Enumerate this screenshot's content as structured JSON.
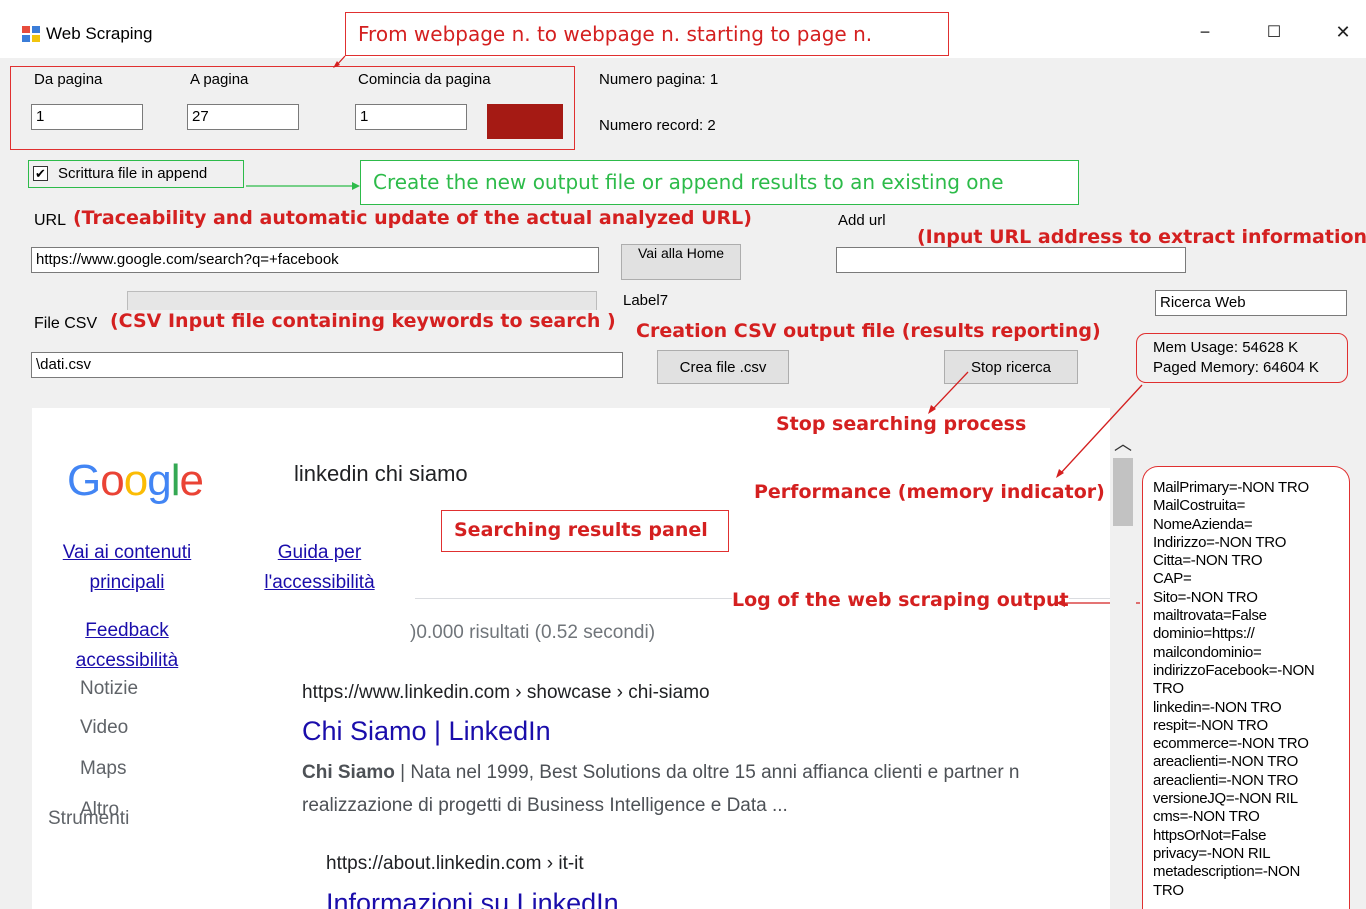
{
  "window": {
    "title": "Web Scraping",
    "minimize": "−",
    "maximize": "☐",
    "close": "✕"
  },
  "form": {
    "da_pagina_label": "Da pagina",
    "da_pagina_value": "1",
    "a_pagina_label": "A pagina",
    "a_pagina_value": "27",
    "comincia_label": "Comincia da pagina",
    "comincia_value": "1",
    "numero_pagina": "Numero pagina: 1",
    "numero_record": "Numero record: 2",
    "append_checkbox_label": "Scrittura file in append",
    "append_checked": true,
    "url_label": "URL",
    "url_value": "https://www.google.com/search?q=+facebook",
    "vai_home_button": "Vai alla Home",
    "add_url_label": "Add url",
    "add_url_value": "",
    "label7": "Label7",
    "ricerca_web_value": "Ricerca Web",
    "file_csv_label": "File CSV",
    "file_csv_value": "\\dati.csv",
    "crea_file_button": "Crea file .csv",
    "stop_button": "Stop ricerca",
    "mem_usage": "Mem Usage: 54628 K",
    "paged_memory": "Paged Memory: 64604 K"
  },
  "annotations": {
    "pages": "From webpage n.  to webpage n. starting to page n.",
    "append": "Create the new output file or append results to an existing one",
    "url": "(Traceability and automatic update of the actual analyzed URL)",
    "add_url": "(Input URL address to extract information)",
    "csv_input": "(CSV Input file containing keywords to search )",
    "csv_output": "Creation CSV output file (results reporting)",
    "stop": "Stop searching process",
    "performance": "Performance (memory indicator)",
    "results_panel": "Searching results panel",
    "log": "Log of the web scraping output"
  },
  "browser": {
    "logo_letters": [
      "G",
      "o",
      "o",
      "g",
      "l",
      "e"
    ],
    "logo_colors": [
      "#4285f4",
      "#ea4335",
      "#fbbc05",
      "#4285f4",
      "#34a853",
      "#ea4335"
    ],
    "search_query": "linkedin chi siamo",
    "skip_main_line1": "Vai ai contenuti",
    "skip_main_line2": "principali",
    "accessibility_line1": "Guida per",
    "accessibility_line2": "l'accessibilità",
    "feedback_line1": "Feedback",
    "feedback_line2": "accessibilità",
    "results_count": ")0.000 risultati (0.52 secondi)",
    "nav_items": [
      "Notizie",
      "Video",
      "Maps",
      "Altro",
      "Strumenti"
    ],
    "result1_url": "https://www.linkedin.com › showcase › chi-siamo",
    "result1_title": "Chi Siamo | LinkedIn",
    "result1_snippet_bold": "Chi Siamo",
    "result1_snippet_rest": " | Nata nel 1999, Best Solutions da oltre 15 anni affianca clienti e partner n",
    "result1_snippet_line2": "realizzazione di progetti di Business Intelligence e Data ...",
    "result2_url": "https://about.linkedin.com › it-it",
    "result2_title": "Informazioni su LinkedIn"
  },
  "log_lines": [
    "MailPrimary=-NON TRO",
    "MailCostruita=",
    "NomeAzienda=",
    "Indirizzo=-NON TRO",
    "Citta=-NON TRO",
    "CAP=",
    "Sito=-NON TRO",
    "mailtrovata=False",
    "dominio=https://",
    "mailcondominio=",
    "indirizzoFacebook=-NON",
    "TRO",
    "linkedin=-NON TRO",
    "respit=-NON TRO",
    "ecommerce=-NON TRO",
    "areaclienti=-NON TRO",
    "areaclienti=-NON TRO",
    "versioneJQ=-NON RIL",
    "cms=-NON TRO",
    "httpsOrNot=False",
    "privacy=-NON RIL",
    "metadescription=-NON",
    "TRO"
  ],
  "colors": {
    "annotation_red": "#d42020",
    "annotation_green": "#2dbb4a",
    "color_swatch": "#a51a14",
    "link_blue": "#1a0dab",
    "google_link": "#1a0dab"
  }
}
